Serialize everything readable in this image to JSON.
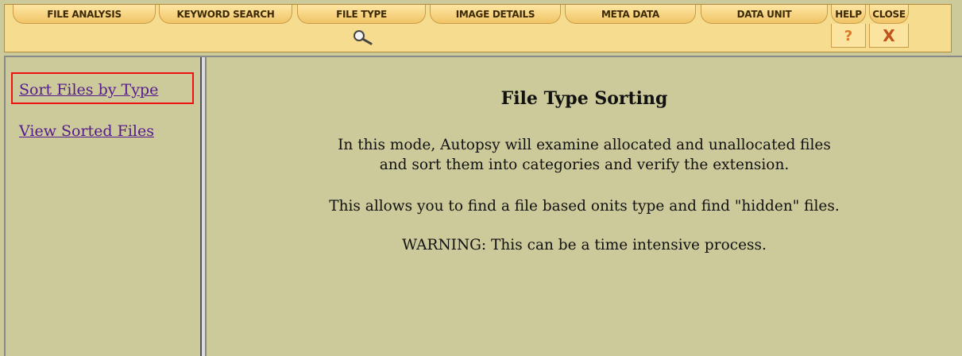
{
  "toolbar": {
    "tabs": [
      {
        "label": "File Analysis"
      },
      {
        "label": "Keyword Search"
      },
      {
        "label": "File Type"
      },
      {
        "label": "Image Details"
      },
      {
        "label": "Meta Data"
      },
      {
        "label": "Data Unit"
      },
      {
        "label": "Help"
      },
      {
        "label": "Close"
      }
    ],
    "help_glyph": "?",
    "close_glyph": "X",
    "active_icon": "magnifier-icon"
  },
  "sidebar": {
    "links": [
      {
        "label": "Sort Files by Type",
        "highlighted": true
      },
      {
        "label": "View Sorted Files"
      }
    ]
  },
  "main": {
    "title": "File Type Sorting",
    "lines": [
      "In this mode, Autopsy will examine allocated and unallocated files",
      "and sort them into categories and verify the extension.",
      "This allows you to find a file based onits type and find \"hidden\" files.",
      "WARNING: This can be a time intensive process."
    ]
  },
  "colors": {
    "background": "#ccc99a",
    "toolbar": "#f6dc8e",
    "link": "#551a8b",
    "highlight_box": "#ee1111",
    "accent": "#c0531b"
  }
}
